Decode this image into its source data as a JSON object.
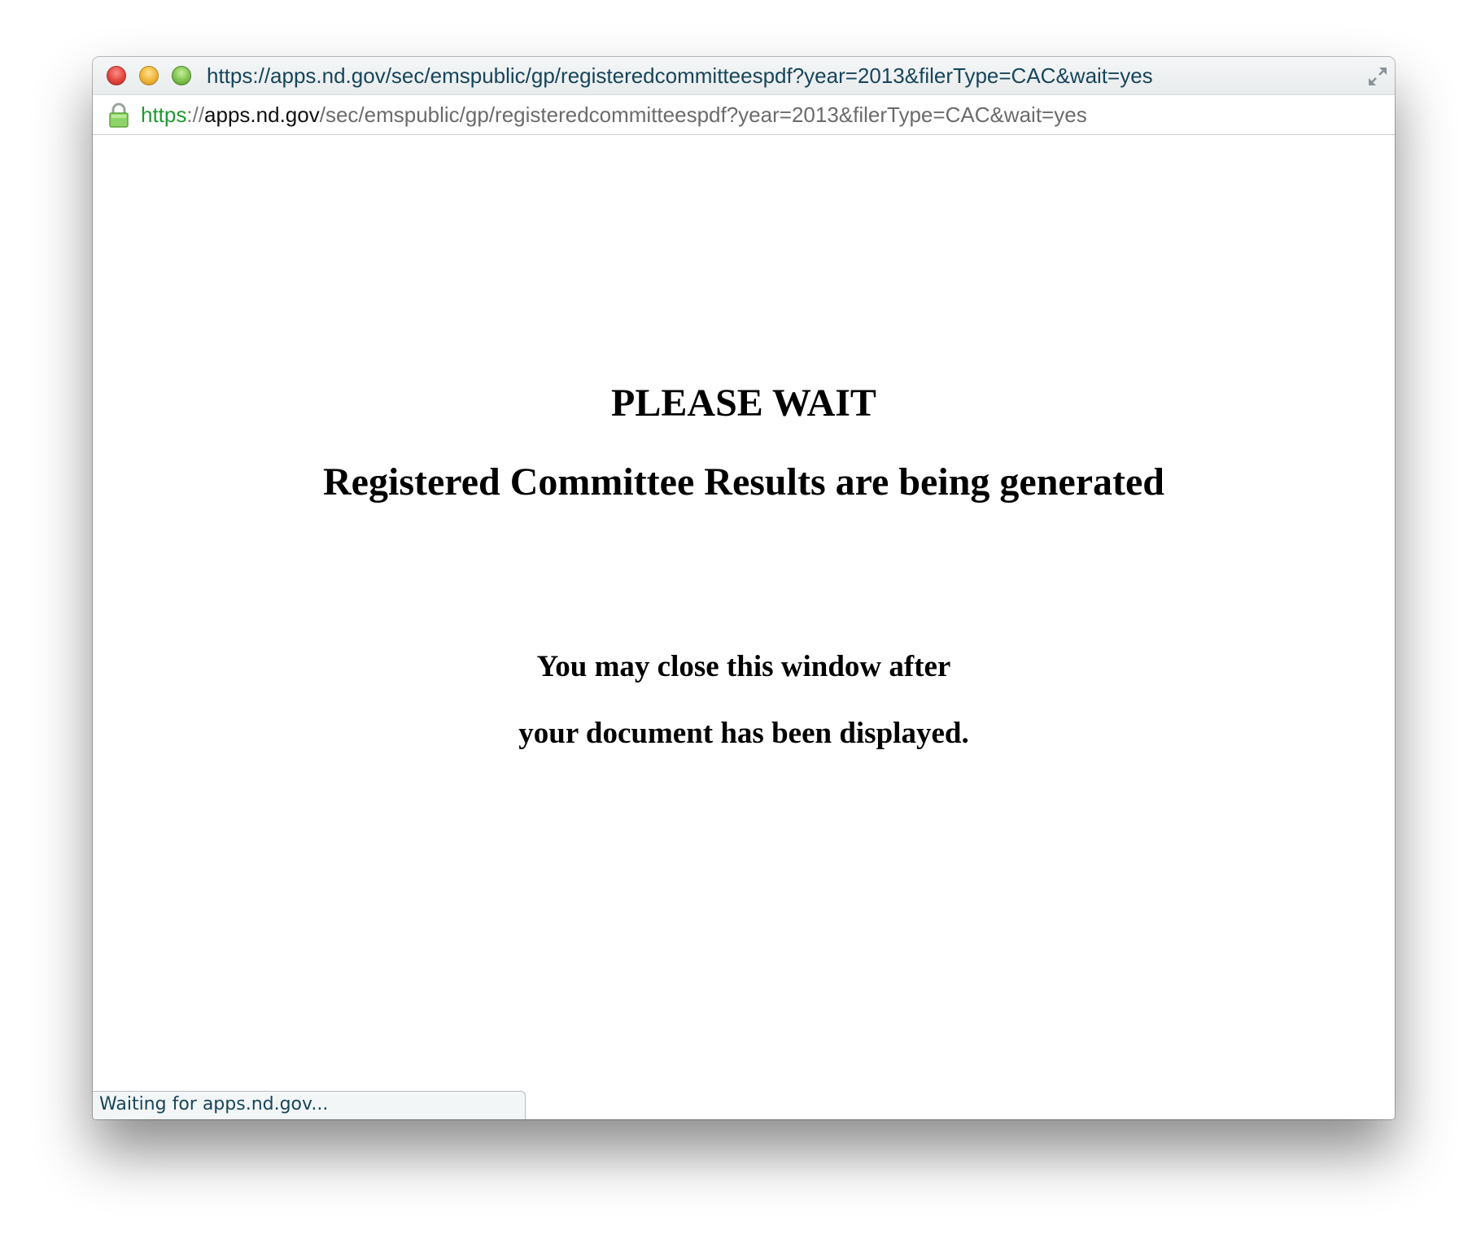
{
  "window": {
    "title": "https://apps.nd.gov/sec/emspublic/gp/registeredcommitteespdf?year=2013&filerType=CAC&wait=yes",
    "controls": {
      "close_icon": "close-icon",
      "minimize_icon": "minimize-icon",
      "zoom_icon": "zoom-icon",
      "fullscreen_icon": "fullscreen-icon"
    }
  },
  "address_bar": {
    "security_icon": "lock-icon",
    "scheme": "https",
    "separator": "://",
    "host": "apps.nd.gov",
    "path": "/sec/emspublic/gp/registeredcommitteespdf?year=2013&filerType=CAC&wait=yes"
  },
  "page": {
    "heading": "PLEASE WAIT",
    "subheading": "Registered Committee Results are being generated",
    "note_line1": "You may close this window after",
    "note_line2": "your document has been displayed."
  },
  "status_bar": {
    "text": "Waiting for apps.nd.gov..."
  },
  "colors": {
    "title_text": "#17455a",
    "scheme_green": "#1f9a2f",
    "host_black": "#111111",
    "path_gray": "#6b6b6b",
    "lock_green": "#8fd46a"
  }
}
